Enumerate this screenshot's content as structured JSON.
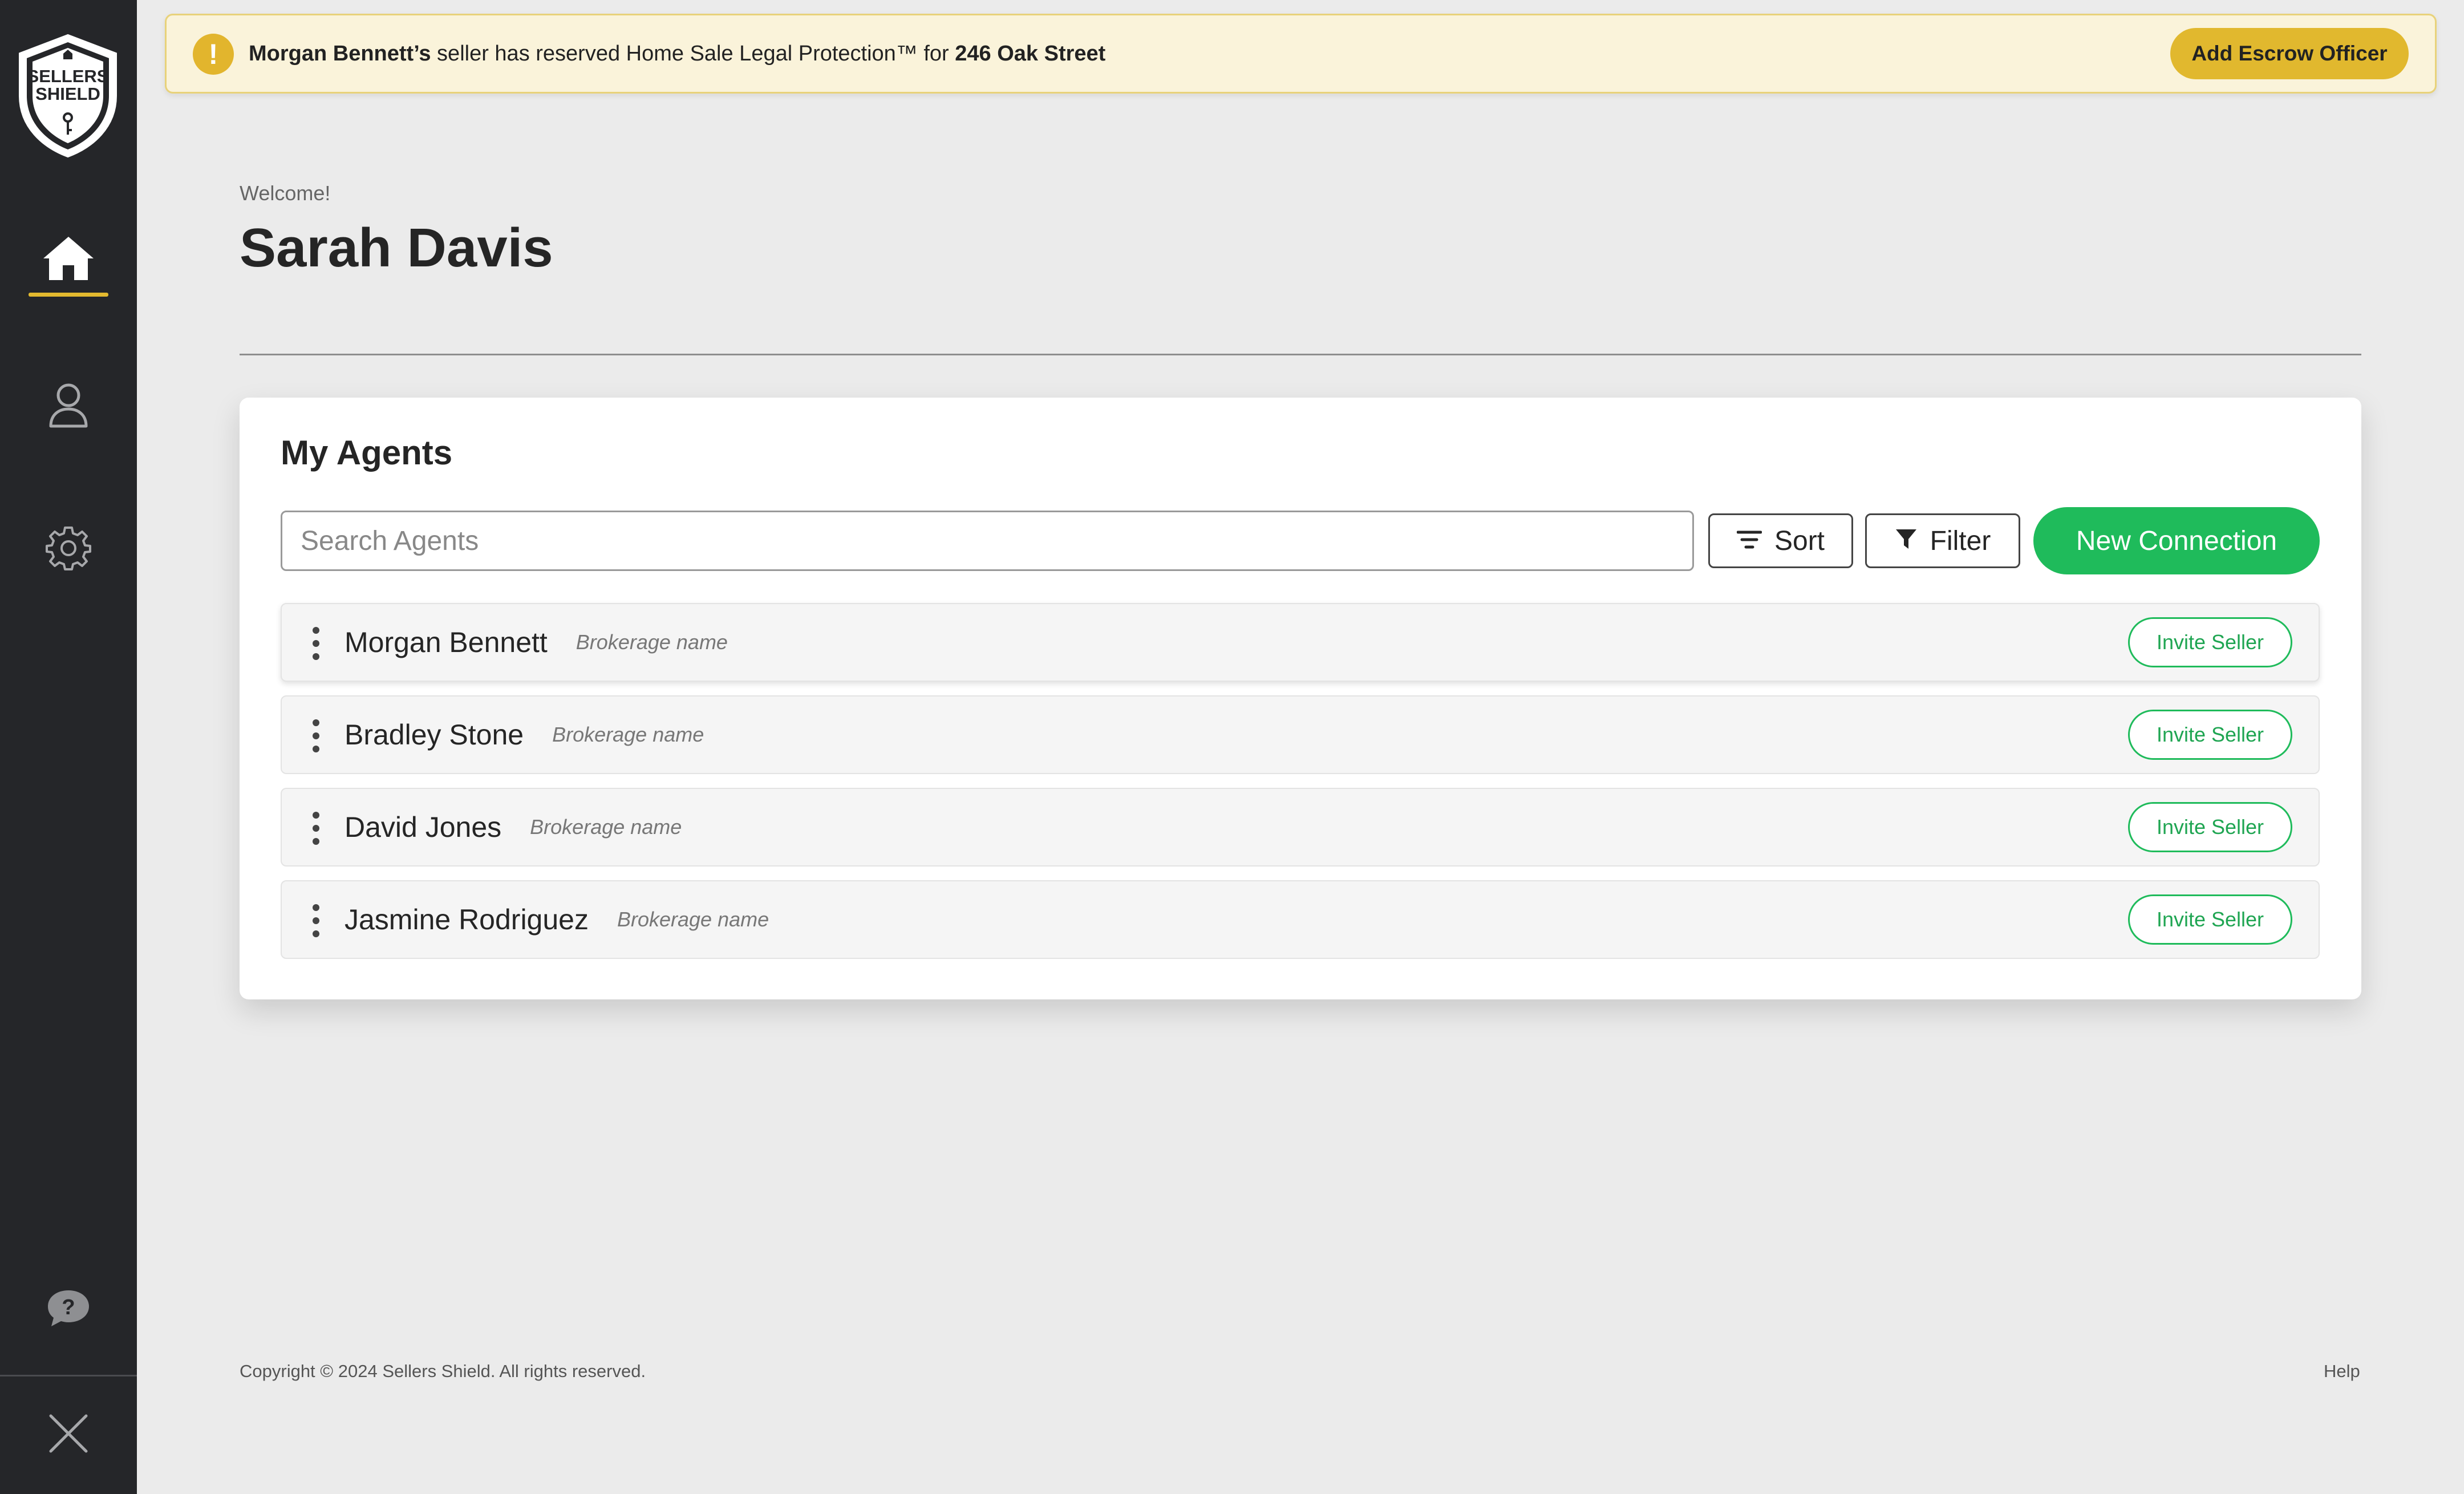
{
  "sidebar": {
    "logo_text_line1": "SELLERS",
    "logo_text_line2": "SHIELD",
    "nav": [
      {
        "name": "home",
        "icon": "home-icon",
        "active": true
      },
      {
        "name": "profile",
        "icon": "user-icon",
        "active": false
      },
      {
        "name": "settings",
        "icon": "gear-icon",
        "active": false
      },
      {
        "name": "help",
        "icon": "help-bubble-icon",
        "active": false
      },
      {
        "name": "close",
        "icon": "close-icon",
        "active": false
      }
    ],
    "accent_color": "#e3b92f"
  },
  "banner": {
    "icon": "!",
    "agent_name": "Morgan Bennett’s",
    "message_middle": " seller has reserved Home Sale Legal Protection™ for ",
    "address": "246 Oak Street",
    "button_label": "Add Escrow Officer",
    "button_color": "#e1b82e"
  },
  "welcome": {
    "greeting": "Welcome!",
    "user_name": "Sarah Davis"
  },
  "agents_card": {
    "title": "My Agents",
    "search_placeholder": "Search Agents",
    "sort_label": "Sort",
    "filter_label": "Filter",
    "new_connection_label": "New Connection",
    "primary_color": "#1fbb5b",
    "agents": [
      {
        "name": "Morgan Bennett",
        "brokerage": "Brokerage name",
        "action": "Invite Seller"
      },
      {
        "name": "Bradley Stone",
        "brokerage": "Brokerage name",
        "action": "Invite Seller"
      },
      {
        "name": "David Jones",
        "brokerage": "Brokerage name",
        "action": "Invite Seller"
      },
      {
        "name": "Jasmine Rodriguez",
        "brokerage": "Brokerage name",
        "action": "Invite Seller"
      }
    ]
  },
  "footer": {
    "copyright": "Copyright © 2024 Sellers Shield. All rights reserved.",
    "help_link": "Help"
  }
}
